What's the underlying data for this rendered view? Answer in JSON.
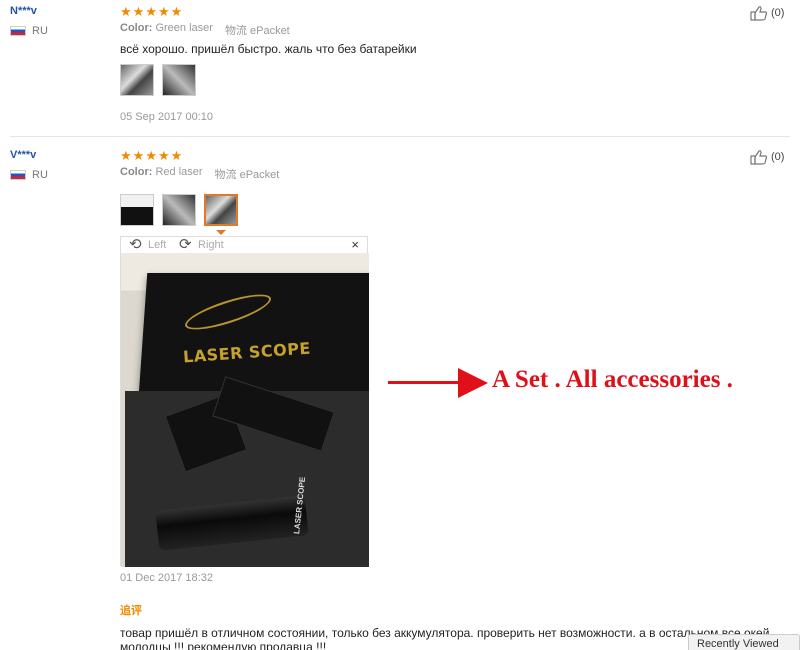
{
  "reviews": [
    {
      "user": "N***v",
      "country": "RU",
      "rating": 5,
      "color_label": "Color:",
      "color_value": "Green laser",
      "shipping": "物流 ePacket",
      "text": "всё хорошо. пришёл быстро. жаль что без батарейки",
      "date": "05 Sep 2017 00:10",
      "helpful_count": "(0)"
    },
    {
      "user": "V***v",
      "country": "RU",
      "rating": 5,
      "color_label": "Color:",
      "color_value": "Red laser",
      "shipping": "物流 ePacket",
      "date": "01 Dec 2017 18:32",
      "helpful_count": "(0)",
      "additional_label": "追评",
      "additional_text_1": "товар пришёл в отличном состоянии, только без аккумулятора. проверить нет возможности. а в остальном все окей",
      "additional_text_2": "молодцы !!! рекомендую продавца !!!"
    }
  ],
  "viewer": {
    "rotate_left": "Left",
    "rotate_right": "Right",
    "close": "×",
    "photo_box_text": "LASER SCOPE",
    "photo_scope_text": "LASER SCOPE"
  },
  "annotation": {
    "text": "A Set . All accessories ."
  },
  "recently_viewed": "Recently Viewed",
  "colors": {
    "accent_orange": "#f08a00",
    "username_blue": "#2255aa",
    "annotation_red": "#e0101a"
  },
  "icons": {
    "helpful": "thumbs-up-icon",
    "rotate_left": "rotate-left-icon",
    "rotate_right": "rotate-right-icon",
    "close": "close-icon",
    "flag": "russia-flag-icon",
    "star": "star-icon"
  }
}
